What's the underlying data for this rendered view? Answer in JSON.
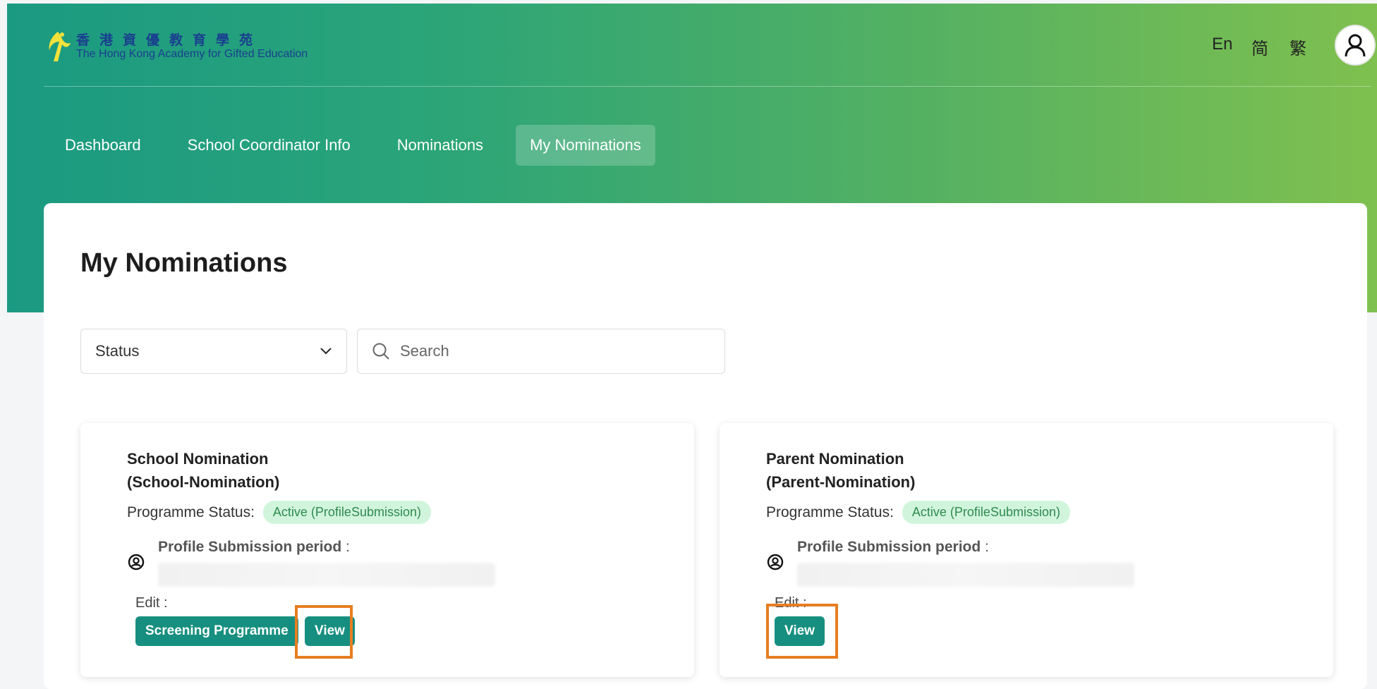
{
  "header": {
    "logo_cn": "香港資優教育學苑",
    "logo_en": "The Hong Kong Academy for Gifted Education",
    "languages": [
      "En",
      "简",
      "繁"
    ],
    "avatar_icon": "user-icon"
  },
  "nav": {
    "items": [
      {
        "label": "Dashboard",
        "active": false
      },
      {
        "label": "School Coordinator Info",
        "active": false
      },
      {
        "label": "Nominations",
        "active": false
      },
      {
        "label": "My Nominations",
        "active": true
      }
    ]
  },
  "main": {
    "title": "My Nominations",
    "status_filter": {
      "value": "Status"
    },
    "search": {
      "placeholder": "Search"
    },
    "cards": [
      {
        "name": "School Nomination",
        "code": "(School-Nomination)",
        "status_label": "Programme Status:",
        "status_badge": "Active (ProfileSubmission)",
        "period_label": "Profile Submission period",
        "period_sep": " :",
        "edit_label": "Edit :",
        "buttons": [
          "Screening Programme",
          "View"
        ]
      },
      {
        "name": "Parent Nomination",
        "code": "(Parent-Nomination)",
        "status_label": "Programme Status:",
        "status_badge": "Active (ProfileSubmission)",
        "period_label": "Profile Submission period",
        "period_sep": " :",
        "edit_label": "Edit :",
        "buttons": [
          "View"
        ]
      }
    ]
  },
  "colors": {
    "accent": "#168f80",
    "highlight": "#e67e22",
    "badge_bg": "#d1f5dc",
    "badge_text": "#2f8a50"
  }
}
